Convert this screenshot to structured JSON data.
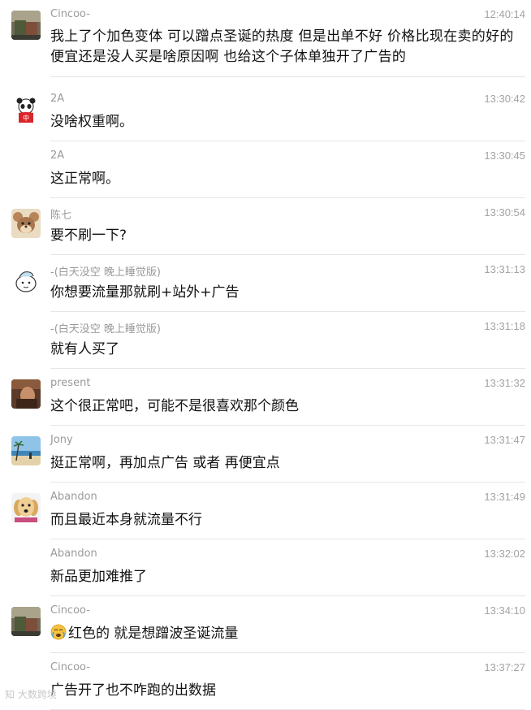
{
  "messages": [
    {
      "sender": "Cincoo-",
      "time": "12:40:14",
      "text": "我上了个加色变体 可以蹭点圣诞的热度 但是出单不好 价格比现在卖的好的便宜还是没人买是啥原因啊 也给这个子体单独开了广告的",
      "avatar": "photo-avatar-cincoo"
    },
    {
      "sender": "2A",
      "time": "13:30:42",
      "text": "没啥权重啊。",
      "avatar": "panda-avatar"
    },
    {
      "sender": "2A",
      "time": "13:30:45",
      "text": "这正常啊。",
      "avatar": ""
    },
    {
      "sender": "陈七",
      "time": "13:30:54",
      "text": "要不刷一下?",
      "avatar": "cartoon-mouse-avatar"
    },
    {
      "sender": "-(白天没空 晚上睡觉版)",
      "time": "13:31:13",
      "text": "你想要流量那就刷+站外+广告",
      "avatar": "cartoon-face-avatar"
    },
    {
      "sender": "-(白天没空 晚上睡觉版)",
      "time": "13:31:18",
      "text": "就有人买了",
      "avatar": ""
    },
    {
      "sender": "present",
      "time": "13:31:32",
      "text": "这个很正常吧，可能不是很喜欢那个颜色",
      "avatar": "photo-avatar-present"
    },
    {
      "sender": "Jony",
      "time": "13:31:47",
      "text": "挺正常啊，再加点广告 或者 再便宜点",
      "avatar": "beach-avatar"
    },
    {
      "sender": "Abandon",
      "time": "13:31:49",
      "text": "而且最近本身就流量不行",
      "avatar": "dog-avatar"
    },
    {
      "sender": "Abandon",
      "time": "13:32:02",
      "text": "新品更加难推了",
      "avatar": ""
    },
    {
      "sender": "Cincoo-",
      "time": "13:34:10",
      "text": "红色的 就是想蹭波圣诞流量",
      "avatar": "photo-avatar-cincoo",
      "emoji": "crying-face-emoji"
    },
    {
      "sender": "Cincoo-",
      "time": "13:37:27",
      "text": "广告开了也不咋跑的出数据",
      "avatar": ""
    }
  ],
  "watermark": "知 大数跨境",
  "colors": {
    "name": "#9a9a9a",
    "time": "#a3a3a3",
    "text": "#111111",
    "divider": "#e6e6e6"
  }
}
